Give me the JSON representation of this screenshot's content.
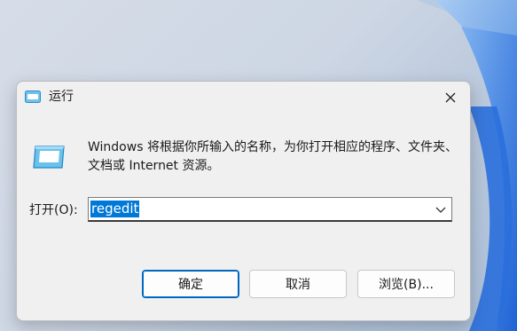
{
  "dialog": {
    "title": "运行",
    "description": "Windows 将根据你所输入的名称，为你打开相应的程序、文件夹、文档或 Internet 资源。",
    "open_label": "打开(O):",
    "open_value": "regedit",
    "buttons": {
      "ok": "确定",
      "cancel": "取消",
      "browse": "浏览(B)..."
    }
  },
  "icons": {
    "title_icon": "run-app-icon",
    "body_icon": "run-app-icon",
    "close": "close-icon",
    "dropdown": "chevron-down-icon"
  },
  "colors": {
    "selection": "#0078d7",
    "primary_border": "#0067c0",
    "dialog_bg": "#f0f0f0"
  }
}
